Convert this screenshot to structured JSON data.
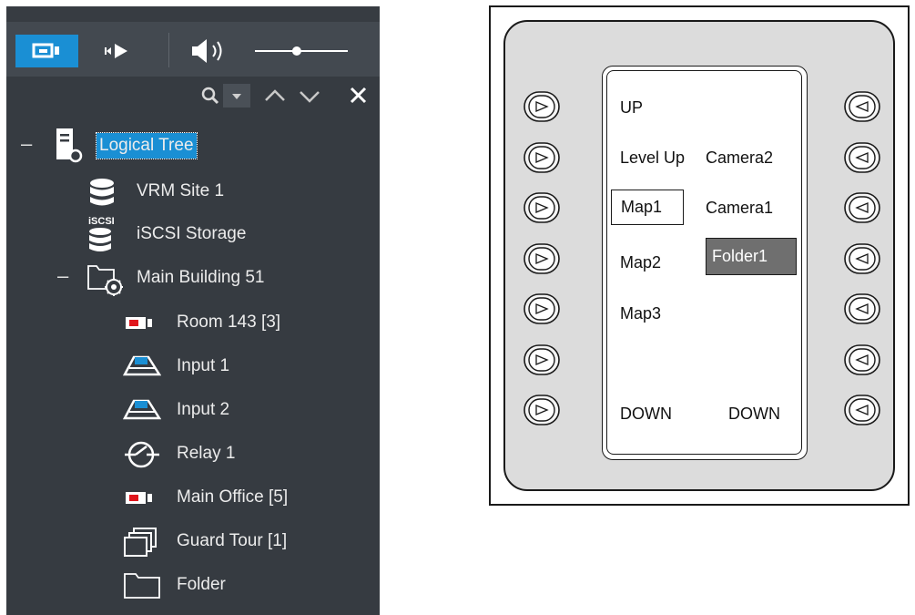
{
  "toolbar": {
    "buttons": [
      {
        "name": "camera-mode-icon",
        "active": true
      },
      {
        "name": "playback-mode-icon",
        "active": false
      },
      {
        "name": "volume-icon",
        "active": false
      }
    ],
    "volume_level": 0.45
  },
  "search_bar": {
    "icons": [
      "search-icon",
      "chevron-down-icon",
      "up-arrow-icon",
      "down-arrow-icon",
      "close-icon"
    ]
  },
  "tree": {
    "root": {
      "label": "Logical Tree",
      "icon": "server-icon",
      "expanded": true,
      "selected": true
    },
    "items": [
      {
        "label": "VRM Site 1",
        "icon": "database-icon"
      },
      {
        "label": "iSCSI Storage",
        "icon": "iscsi-storage-icon",
        "icon_text": "iSCSI"
      },
      {
        "label": "Main Building 51",
        "icon": "folder-gear-icon",
        "expanded": true
      },
      {
        "label": "Room 143 [3]",
        "icon": "camera-icon"
      },
      {
        "label": "Input 1",
        "icon": "input-icon"
      },
      {
        "label": "Input 2",
        "icon": "input-icon"
      },
      {
        "label": "Relay 1",
        "icon": "relay-icon"
      },
      {
        "label": "Main Office [5]",
        "icon": "camera-icon"
      },
      {
        "label": "Guard Tour [1]",
        "icon": "guard-tour-icon"
      },
      {
        "label": "Folder",
        "icon": "folder-icon"
      }
    ],
    "collapse_symbol": "–"
  },
  "keypad": {
    "left_column": [
      "UP",
      "Level Up",
      "Map1",
      "Map2",
      "Map3",
      "",
      "DOWN"
    ],
    "right_column": [
      "",
      "Camera2",
      "Camera1",
      "Folder1",
      "",
      "",
      "DOWN"
    ],
    "selected_left": "Map1",
    "selected_right": "Folder1",
    "left_key_icon": "right-triangle-icon",
    "right_key_icon": "left-triangle-icon",
    "colors": {
      "panel_fill": "#dcdcdc",
      "selected_fill": "#6f6f6f"
    }
  }
}
